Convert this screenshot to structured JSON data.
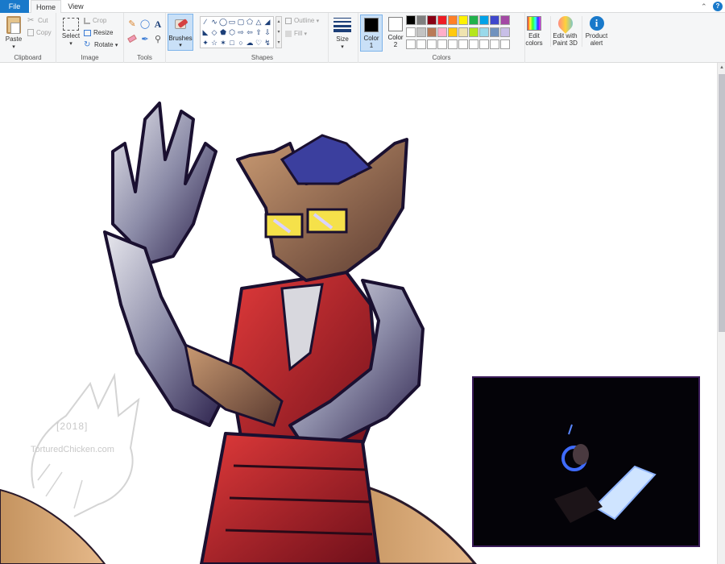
{
  "tabs": {
    "file": "File",
    "home": "Home",
    "view": "View"
  },
  "clipboard": {
    "paste": "Paste",
    "cut": "Cut",
    "copy": "Copy",
    "label": "Clipboard"
  },
  "image": {
    "select": "Select",
    "crop": "Crop",
    "resize": "Resize",
    "rotate": "Rotate",
    "label": "Image"
  },
  "tools": {
    "label": "Tools",
    "text_glyph": "A"
  },
  "brushes": {
    "label": "Brushes"
  },
  "shapes": {
    "label": "Shapes",
    "outline": "Outline",
    "fill": "Fill"
  },
  "size": {
    "label": "Size"
  },
  "colors": {
    "color1_label": "Color 1",
    "color2_label": "Color 2",
    "label": "Colors",
    "color1_value": "#000000",
    "color2_value": "#ffffff",
    "palette_row1": [
      "#000000",
      "#7f7f7f",
      "#880015",
      "#ed1c24",
      "#ff7f27",
      "#fff200",
      "#22b14c",
      "#00a2e8",
      "#3f48cc",
      "#a349a4"
    ],
    "palette_row2": [
      "#ffffff",
      "#c3c3c3",
      "#b97a57",
      "#ffaec9",
      "#ffc90e",
      "#efe4b0",
      "#b5e61d",
      "#99d9ea",
      "#7092be",
      "#c8bfe7"
    ]
  },
  "edit_colors": {
    "line1": "Edit",
    "line2": "colors"
  },
  "paint3d": {
    "line1": "Edit with",
    "line2": "Paint 3D"
  },
  "product_alert": {
    "line1": "Product",
    "line2": "alert"
  },
  "help_glyph": "?",
  "watermark": {
    "year": "[2018]",
    "site": "TorturedChicken.com"
  }
}
